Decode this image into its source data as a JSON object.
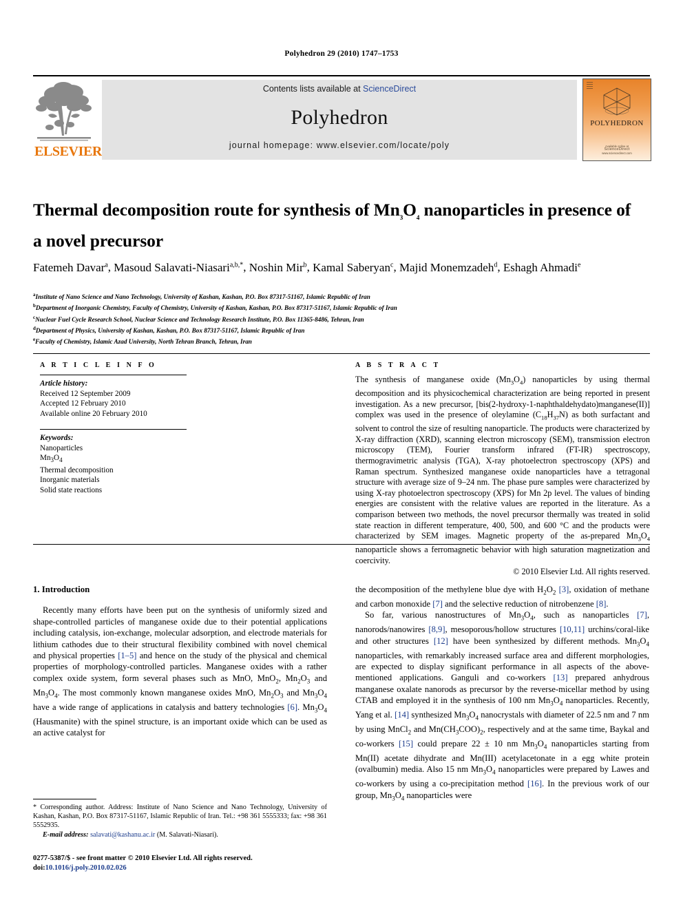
{
  "running_head": "Polyhedron 29 (2010) 1747–1753",
  "masthead": {
    "contents_prefix": "Contents lists available at ",
    "sciencedirect": "ScienceDirect",
    "journal_name": "Polyhedron",
    "homepage": "journal homepage: www.elsevier.com/locate/poly",
    "publisher_logo_word": "ELSEVIER",
    "publisher_logo_icon": "elsevier-tree-icon",
    "cover": {
      "title": "POLYHEDRON",
      "footer_top": "Available online at",
      "footer_brand": "ScienceDirect",
      "footer_bottom": "www.sciencedirect.com",
      "icon": "polyhedron-wireframe-icon"
    },
    "accent_orange": "#E8770D",
    "link_blue": "#2b4b9b",
    "band_gray": "#e3e3e3"
  },
  "article": {
    "title_part1": "Thermal decomposition route for synthesis of Mn",
    "title_sub1": "3",
    "title_part2": "O",
    "title_sub2": "4",
    "title_part3": " nanoparticles in presence of a novel precursor",
    "authors": [
      {
        "name": "Fatemeh Davar",
        "marks": "a"
      },
      {
        "name": "Masoud Salavati-Niasari",
        "marks": "a,b,*"
      },
      {
        "name": "Noshin Mir",
        "marks": "b"
      },
      {
        "name": "Kamal Saberyan",
        "marks": "c"
      },
      {
        "name": "Majid Monemzadeh",
        "marks": "d"
      },
      {
        "name": "Eshagh Ahmadi",
        "marks": "e"
      }
    ],
    "affiliations": [
      {
        "mark": "a",
        "text": "Institute of Nano Science and Nano Technology, University of Kashan, Kashan, P.O. Box 87317-51167, Islamic Republic of Iran"
      },
      {
        "mark": "b",
        "text": "Department of Inorganic Chemistry, Faculty of Chemistry, University of Kashan, Kashan, P.O. Box 87317-51167, Islamic Republic of Iran"
      },
      {
        "mark": "c",
        "text": "Nuclear Fuel Cycle Research School, Nuclear Science and Technology Research Institute, P.O. Box 11365-8486, Tehran, Iran"
      },
      {
        "mark": "d",
        "text": "Department of Physics, University of Kashan, Kashan, P.O. Box 87317-51167, Islamic Republic of Iran"
      },
      {
        "mark": "e",
        "text": "Faculty of Chemistry, Islamic Azad University, North Tehran Branch, Tehran, Iran"
      }
    ]
  },
  "article_info": {
    "heading": "A R T I C L E   I N F O",
    "history_label": "Article history:",
    "history": [
      "Received 12 September 2009",
      "Accepted 12 February 2010",
      "Available online 20 February 2010"
    ],
    "keywords_label": "Keywords:",
    "keywords": [
      "Nanoparticles",
      "Mn3O4",
      "Thermal decomposition",
      "Inorganic materials",
      "Solid state reactions"
    ]
  },
  "abstract": {
    "heading": "A B S T R A C T",
    "text": "The synthesis of manganese oxide (Mn3O4) nanoparticles by using thermal decomposition and its physicochemical characterization are being reported in present investigation. As a new precursor, [bis(2-hydroxy-1-naphthaldehydato)manganese(II)] complex was used in the presence of oleylamine (C18H37N) as both surfactant and solvent to control the size of resulting nanoparticle. The products were characterized by X-ray diffraction (XRD), scanning electron microscopy (SEM), transmission electron microscopy (TEM), Fourier transform infrared (FT-IR) spectroscopy, thermogravimetric analysis (TGA), X-ray photoelectron spectroscopy (XPS) and Raman spectrum. Synthesized manganese oxide nanoparticles have a tetragonal structure with average size of 9–24 nm. The phase pure samples were characterized by using X-ray photoelectron spectroscopy (XPS) for Mn 2p level. The values of binding energies are consistent with the relative values are reported in the literature. As a comparison between two methods, the novel precursor thermally was treated in solid state reaction in different temperature, 400, 500, and 600 °C and the products were characterized by SEM images. Magnetic property of the as-prepared Mn3O4 nanoparticle shows a ferromagnetic behavior with high saturation magnetization and coercivity.",
    "copyright": "© 2010 Elsevier Ltd. All rights reserved."
  },
  "introduction": {
    "heading": "1. Introduction",
    "left_paragraph": "Recently many efforts have been put on the synthesis of uniformly sized and shape-controlled particles of manganese oxide due to their potential applications including catalysis, ion-exchange, molecular adsorption, and electrode materials for lithium cathodes due to their structural flexibility combined with novel chemical and physical properties [1–5] and hence on the study of the physical and chemical properties of morphology-controlled particles. Manganese oxides with a rather complex oxide system, form several phases such as MnO, MnO2, Mn2O3 and Mn3O4. The most commonly known manganese oxides MnO, Mn2O3 and Mn3O4 have a wide range of applications in catalysis and battery technologies [6]. Mn3O4 (Hausmanite) with the spinel structure, is an important oxide which can be used as an active catalyst for",
    "right_paragraph_1": "the decomposition of the methylene blue dye with H2O2 [3], oxidation of methane and carbon monoxide [7] and the selective reduction of nitrobenzene [8].",
    "right_paragraph_2": "So far, various nanostructures of Mn3O4, such as nanoparticles [7], nanorods/nanowires [8,9], mesoporous/hollow structures [10,11] urchins/coral-like and other structures [12] have been synthesized by different methods. Mn3O4 nanoparticles, with remarkably increased surface area and different morphologies, are expected to display significant performance in all aspects of the above-mentioned applications. Ganguli and co-workers [13] prepared anhydrous manganese oxalate nanorods as precursor by the reverse-micellar method by using CTAB and employed it in the synthesis of 100 nm Mn3O4 nanoparticles. Recently, Yang et al. [14] synthesized Mn3O4 nanocrystals with diameter of 22.5 nm and 7 nm by using MnCl2 and Mn(CH3COO)2, respectively and at the same time, Baykal and co-workers [15] could prepare 22 ± 10 nm Mn3O4 nanoparticles starting from Mn(II) acetate dihydrate and Mn(III) acetylacetonate in a egg white protein (ovalbumin) media. Also 15 nm Mn3O4 nanoparticles were prepared by Lawes and co-workers by using a co-precipitation method [16]. In the previous work of our group, Mn3O4 nanoparticles were"
  },
  "footnotes": {
    "corresponding": "* Corresponding author. Address: Institute of Nano Science and Nano Technology, University of Kashan, Kashan, P.O. Box 87317-51167, Islamic Republic of Iran. Tel.: +98 361 5555333; fax: +98 361 5552935.",
    "email_label": "E-mail address:",
    "email": "salavati@kashanu.ac.ir",
    "email_suffix": "(M. Salavati-Niasari).",
    "imprint": "0277-5387/$ - see front matter © 2010 Elsevier Ltd. All rights reserved.",
    "doi_label": "doi:",
    "doi": "10.1016/j.poly.2010.02.026"
  }
}
